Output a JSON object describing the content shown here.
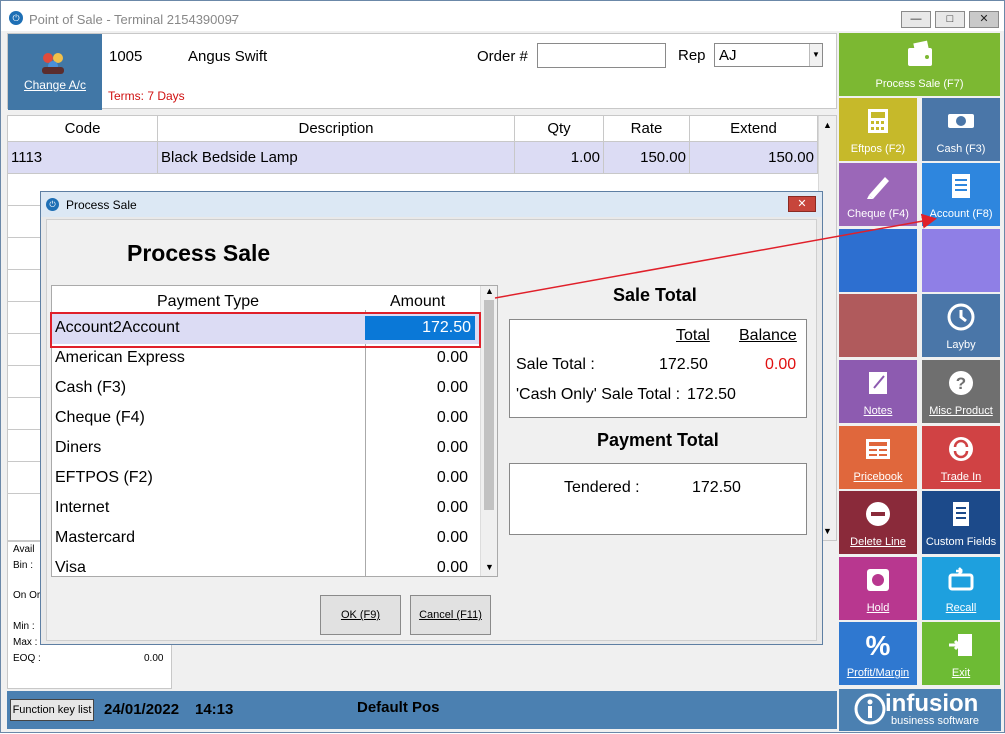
{
  "window": {
    "title": "Point of Sale - Terminal 2154390097",
    "title_suffix": "-",
    "buttons": [
      "minimize",
      "restore",
      "close"
    ]
  },
  "header": {
    "change_account_label": "Change A/c",
    "account_code": "1005",
    "account_name": "Angus Swift",
    "terms": "Terms: 7 Days",
    "order_label": "Order #",
    "order_value": "",
    "rep_label": "Rep",
    "rep_value": "AJ"
  },
  "grid": {
    "columns": [
      "Code",
      "Description",
      "Qty",
      "Rate",
      "Extend"
    ],
    "rows": [
      {
        "code": "1113",
        "description": "Black Bedside Lamp",
        "qty": "1.00",
        "rate": "150.00",
        "extend": "150.00"
      }
    ]
  },
  "stock_panel": {
    "avail": "Avail",
    "bin": "Bin :",
    "on_order": "On Or",
    "min": "Min :",
    "max": "Max :",
    "eoq": "EOQ :",
    "eoq_value": "0.00"
  },
  "bottom_bar": {
    "function_key_list": "Function key list",
    "date": "24/01/2022",
    "time": "14:13",
    "pos_name": "Default Pos"
  },
  "tiles": [
    {
      "label": "Process Sale (F7)",
      "color": "#7cb832",
      "icon": "wallet-icon"
    },
    {
      "label": "Eftpos (F2)",
      "color": "#c6b92a",
      "icon": "calculator-icon"
    },
    {
      "label": "Cash (F3)",
      "color": "#4a76a8",
      "icon": "cash-icon"
    },
    {
      "label": "Cheque (F4)",
      "color": "#9b67b8",
      "icon": "pen-icon"
    },
    {
      "label": "Account (F8)",
      "color": "#2e86de",
      "icon": "document-icon"
    },
    {
      "label": "",
      "color": "#2d6fd0",
      "icon": ""
    },
    {
      "label": "",
      "color": "#8f7fe6",
      "icon": ""
    },
    {
      "label": "",
      "color": "#b05a5c",
      "icon": ""
    },
    {
      "label": "Layby",
      "color": "#4a76a8",
      "icon": "clock-icon"
    },
    {
      "label": "Notes",
      "color": "#8d5bb0",
      "icon": "notepad-icon"
    },
    {
      "label": "Misc Product",
      "color": "#6f6f6f",
      "icon": "question-icon"
    },
    {
      "label": "Pricebook",
      "color": "#e0673c",
      "icon": "book-icon"
    },
    {
      "label": "Trade In",
      "color": "#d04244",
      "icon": "swap-icon"
    },
    {
      "label": "Delete Line",
      "color": "#8a2a3a",
      "icon": "minus-circle-icon"
    },
    {
      "label": "Custom Fields",
      "color": "#1c4a8a",
      "icon": "list-icon"
    },
    {
      "label": "Hold",
      "color": "#b8378f",
      "icon": "stop-icon"
    },
    {
      "label": "Recall",
      "color": "#1ea0de",
      "icon": "recall-icon"
    },
    {
      "label": "Profit/Margin",
      "color": "#2f78d0",
      "icon": "percent-icon"
    },
    {
      "label": "Exit",
      "color": "#6dbb34",
      "icon": "exit-icon"
    }
  ],
  "logo": {
    "brand": "infusion",
    "sub": "business software"
  },
  "dialog": {
    "title": "Process Sale",
    "heading": "Process Sale",
    "payment_type_header": "Payment Type",
    "amount_header": "Amount",
    "payments": [
      {
        "name": "Account2Account",
        "amount": "172.50"
      },
      {
        "name": "American Express",
        "amount": "0.00"
      },
      {
        "name": "Cash (F3)",
        "amount": "0.00"
      },
      {
        "name": "Cheque (F4)",
        "amount": "0.00"
      },
      {
        "name": "Diners",
        "amount": "0.00"
      },
      {
        "name": "EFTPOS (F2)",
        "amount": "0.00"
      },
      {
        "name": "Internet",
        "amount": "0.00"
      },
      {
        "name": "Mastercard",
        "amount": "0.00"
      },
      {
        "name": "Visa",
        "amount": "0.00"
      }
    ],
    "sale_total_heading": "Sale Total",
    "total_col": "Total",
    "balance_col": "Balance",
    "sale_total_label": "Sale Total :",
    "sale_total_value": "172.50",
    "balance_value": "0.00",
    "cash_only_label": "'Cash Only' Sale Total :",
    "cash_only_value": "172.50",
    "payment_total_heading": "Payment Total",
    "tendered_label": "Tendered :",
    "tendered_value": "172.50",
    "ok_label": "OK (F9)",
    "cancel_label": "Cancel (F11)"
  },
  "colors": {
    "highlight_red": "#e0202a",
    "balance_red": "#e01010",
    "selection_blue": "#0a78d7"
  }
}
